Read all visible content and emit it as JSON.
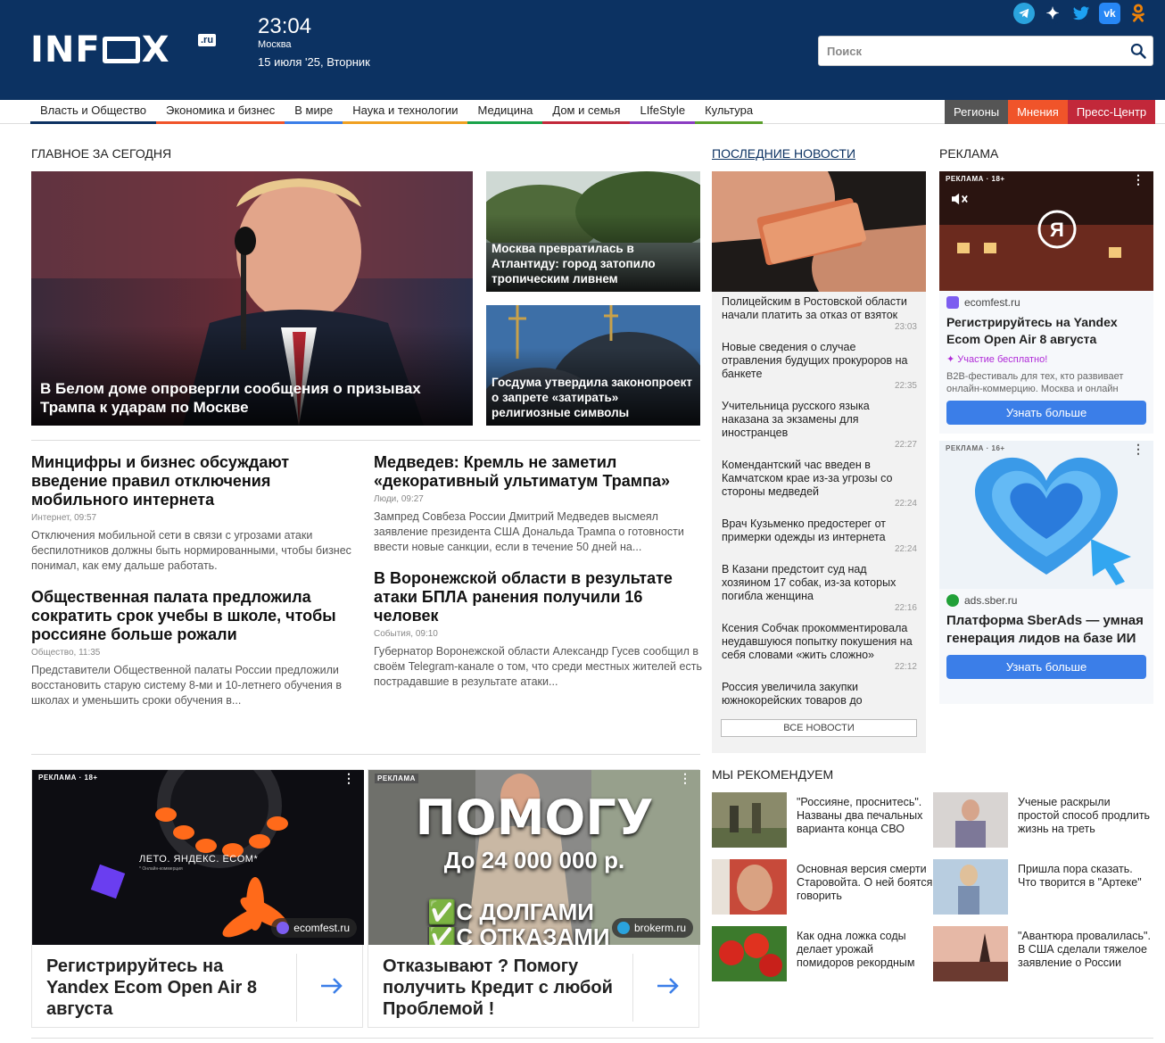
{
  "header": {
    "logo": "INF",
    "logo_tail": "X",
    "logo_ru": ".ru",
    "time": "23:04",
    "city": "Москва",
    "date": "15 июля '25, Вторник",
    "search_placeholder": "Поиск",
    "social": [
      "telegram-icon",
      "zen-icon",
      "twitter-icon",
      "vk-icon",
      "ok-icon"
    ],
    "vk_label": "vk"
  },
  "nav": {
    "items": [
      "Власть и Общество",
      "Экономика и бизнес",
      "В мире",
      "Наука и технологии",
      "Медицина",
      "Дом и семья",
      "LIfeStyle",
      "Культура"
    ],
    "item_colors": [
      "#0c3262",
      "#f0542a",
      "#3b7ee8",
      "#f0a021",
      "#1aa34a",
      "#c2283a",
      "#8a3cc2",
      "#5aa02c"
    ],
    "right": [
      "Регионы",
      "Мнения",
      "Пресс-Центр"
    ]
  },
  "main": {
    "section_title": "Главное за сегодня",
    "hero": {
      "caption": "В Белом доме опровергли сообщения о призывах Трампа к ударам по Москве"
    },
    "side_cards": [
      {
        "caption": "Москва превратилась в Атлантиду: город затопило тропическим ливнем"
      },
      {
        "caption": "Госдума утвердила законопроект о запрете «затирать» религиозные символы"
      }
    ],
    "articles": [
      {
        "title": "Минцифры и бизнес обсуждают введение правил отключения мобильного интернета",
        "meta": "Интернет, 09:57",
        "summary": "Отключения мобильной сети в связи с угрозами атаки беспилотников должны быть нормированными, чтобы бизнес понимал, как ему дальше работать."
      },
      {
        "title": "Медведев: Кремль не заметил «декоративный ультиматум Трампа»",
        "meta": "Люди, 09:27",
        "summary": "Зампред Совбеза России Дмитрий Медведев высмеял заявление президента США Дональда Трампа о готовности ввести новые санкции, если в течение 50 дней на..."
      },
      {
        "title": "Общественная палата предложила сократить срок учебы в школе, чтобы россияне больше рожали",
        "meta": "Общество, 11:35",
        "summary": "Представители Общественной палаты России предложили восстановить старую систему 8-ми и 10-летнего обучения в школах и уменьшить сроки обучения в..."
      },
      {
        "title": "В Воронежской области в результате атаки БПЛА ранения получили 16 человек",
        "meta": "События, 09:10",
        "summary": "Губернатор Воронежской области Александр Гусев сообщил в своём Telegram-канале о том, что среди местных жителей есть пострадавшие в результате атаки..."
      }
    ]
  },
  "latest": {
    "title": "Последние новости",
    "items": [
      {
        "text": "Полицейским в Ростовской области начали платить за отказ от взяток",
        "time": "23:03"
      },
      {
        "text": "Новые сведения о случае отравления будущих прокуроров на банкете",
        "time": "22:35"
      },
      {
        "text": "Учительница русского языка наказана за экзамены для иностранцев",
        "time": "22:27"
      },
      {
        "text": "Комендантский час введен в Камчатском крае из-за угрозы со стороны медведей",
        "time": "22:24"
      },
      {
        "text": "Врач Кузьменко предостерег от примерки одежды из интернета",
        "time": "22:24"
      },
      {
        "text": "В Казани предстоит суд над хозяином 17 собак, из-за которых погибла женщина",
        "time": "22:16"
      },
      {
        "text": "Ксения Собчак прокомментировала неудавшуюся попытку покушения на себя словами «жить сложно»",
        "time": "22:12"
      },
      {
        "text": "Россия увеличила закупки южнокорейских товаров до",
        "time": ""
      }
    ],
    "all_news": "Все новости"
  },
  "ads_right": {
    "title": "Реклама",
    "ad1": {
      "label": "РЕКЛАМА · 18+",
      "domain": "ecomfest.ru",
      "title": "Регистрируйтесь на Yandex Ecom Open Air 8 августа",
      "badge": "Участие бесплатно!",
      "desc": "B2B-фестиваль для тех, кто развивает онлайн-коммерцию. Москва и онлайн",
      "button": "Узнать больше"
    },
    "ad2": {
      "label": "РЕКЛАМА · 16+",
      "domain": "ads.sber.ru",
      "title": "Платформа SberAds — умная генерация лидов на базе ИИ",
      "button": "Узнать больше"
    }
  },
  "ads_bottom": [
    {
      "label": "РЕКЛАМА · 18+",
      "img_text": "ЛЕТО. ЯНДЕКС. ECOM*",
      "img_sub": "* Онлайн-коммерция",
      "domain": "ecomfest.ru",
      "title": "Регистрируйтесь на Yandex Ecom Open Air 8 августа"
    },
    {
      "label": "РЕКЛАМА",
      "img_line1": "ПОМОГУ",
      "img_line2": "До 24 000 000 р.",
      "img_line3": "✅С ДОЛГАМИ",
      "img_line4": "✅С ОТКАЗАМИ",
      "domain": "brokerm.ru",
      "title": "Отказывают ? Помогу получить Кредит с любой Проблемой !"
    }
  ],
  "recommend": {
    "title": "Мы рекомендуем",
    "items": [
      "\"Россияне, проснитесь\". Названы два печальных варианта конца СВО",
      "Ученые раскрыли простой способ продлить жизнь на треть",
      "Основная версия смерти Старовойта. О ней боятся говорить",
      "Пришла пора сказать. Что творится в \"Артеке\"",
      "Как одна ложка соды делает урожай помидоров рекордным",
      "\"Авантюра провалилась\". В США сделали тяжелое заявление о России"
    ]
  },
  "colors": {
    "header_bg": "#0c3262",
    "accent": "#3b7ee8",
    "opinions": "#f0542a",
    "press": "#c2283a"
  }
}
